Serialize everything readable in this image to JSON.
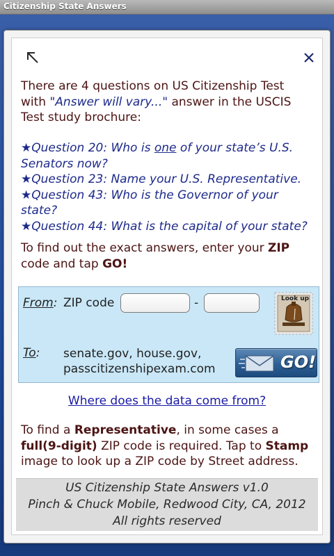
{
  "window": {
    "title": "Citizenship State Answers"
  },
  "intro": {
    "line_a": "There are 4 questions on US Citizenship Test",
    "line_b_prefix": "with ",
    "line_b_quote": "\"Answer will vary...\"",
    "line_b_suffix": " answer in the USCIS",
    "line_c": "Test study brochure:"
  },
  "questions": [
    {
      "star": "★",
      "a": "Question 20: Who is ",
      "b": "one",
      "c": " of your state’s U.S."
    },
    {
      "text": "Senators now?"
    },
    {
      "star": "★",
      "a": "Question 23: Name your U.S. Representative."
    },
    {
      "star": "★",
      "a": "Question 43: Who is the Governor of your"
    },
    {
      "text": "state?"
    },
    {
      "star": "★",
      "a": "Question 44: What is the capital of your state?"
    }
  ],
  "zip_info": {
    "line1_prefix": "To find out the exact answers, enter your ",
    "line1_bold": "ZIP",
    "line2_prefix": "code and tap ",
    "line2_bold": "GO!"
  },
  "lookup": {
    "from_label": "From",
    "from_colon": ":",
    "zip_label": "ZIP code",
    "zip5_value": "",
    "zip4_value": "",
    "dash": "-",
    "to_label": "To",
    "to_colon": ":",
    "to_line1": "senate.gov, house.gov,",
    "to_line2": "passcitizenshipexam.com",
    "go_label": "GO!",
    "stamp_text": "Look up"
  },
  "data_link": "Where does the data come from?",
  "rep_note": {
    "l1_prefix": "To find a ",
    "l1_bold": "Representative",
    "l1_suffix": ", in some cases a",
    "l2_bold": "full(9-digit)",
    "l2_mid": " ZIP code is required. Tap to ",
    "l2_bold2": "Stamp",
    "l3": "image to look up a ZIP code by Street address."
  },
  "footer": {
    "line1": "US Citizenship State Answers v1.0",
    "line2": "Pinch & Chuck Mobile, Redwood City, CA, 2012",
    "line3": "All rights reserved"
  },
  "icons": {
    "expand": "arrow-up-left-icon",
    "close": "close-icon",
    "mail": "envelope-icon",
    "stamp": "liberty-bell-stamp"
  },
  "colors": {
    "body_text": "#4c1414",
    "question_text": "#1d2a8a",
    "lookup_bg": "#c9e7f7",
    "link": "#1a1aa6",
    "go_button": "#2e5f94"
  }
}
